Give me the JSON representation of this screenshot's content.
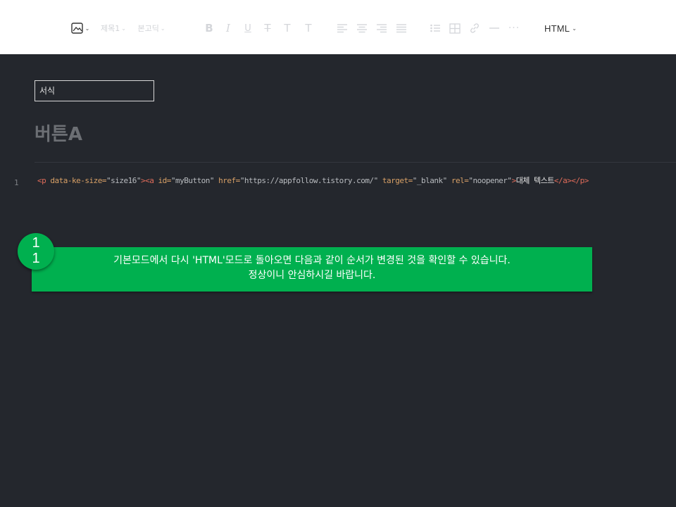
{
  "toolbar": {
    "image_icon": "image-icon",
    "heading_dropdown": "제목1",
    "font_dropdown": "본고딕",
    "format_buttons": [
      "B",
      "I",
      "U",
      "T",
      "T",
      "T"
    ],
    "align_icons": [
      "align-left-icon",
      "align-center-icon",
      "align-right-icon",
      "align-justify-icon"
    ],
    "insert_icons": [
      "list-icon",
      "table-icon",
      "link-icon",
      "horizontal-rule-icon",
      "more-icon"
    ],
    "mode_label": "HTML"
  },
  "editor": {
    "category_placeholder": "서식",
    "title": "버튼A",
    "line_number": "1",
    "code": {
      "open_p": "<p",
      "attr_size": " data-ke-size=",
      "val_size": "\"size16\"",
      "close_p_open_a": "><a",
      "attr_id": " id=",
      "val_id": "\"myButton\"",
      "attr_href": " href=",
      "val_href": "\"https://appfollow.tistory.com/\"",
      "attr_target": " target=",
      "val_target": "\"_blank\"",
      "attr_rel": " rel=",
      "val_rel": "\"noopener\"",
      "gt": ">",
      "text": "대체 텍스트",
      "closing": "</a></p>"
    }
  },
  "annotation": {
    "step_line1": "1",
    "step_line2": "1",
    "line1": "기본모드에서 다시 'HTML'모드로 돌아오면 다음과 같이 순서가 변경된 것을 확인할 수 있습니다.",
    "line2": "정상이니 안심하시길 바랍니다."
  },
  "colors": {
    "editor_bg": "#24272d",
    "toolbar_bg": "#ffffff",
    "annotation_green": "#00b04f",
    "code_tag": "#e06c5a",
    "code_attr": "#d8a066"
  }
}
